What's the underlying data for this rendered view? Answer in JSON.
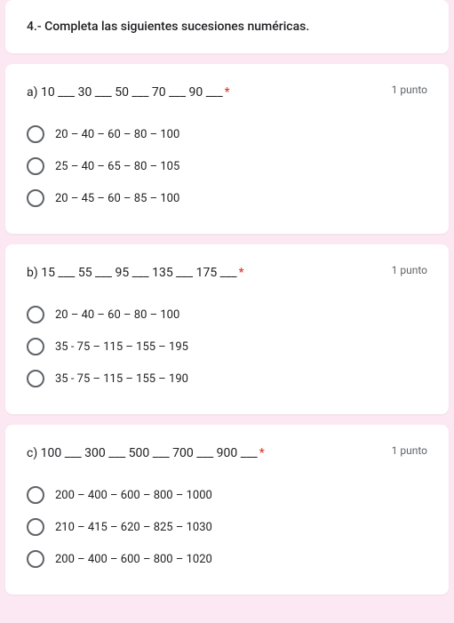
{
  "header": {
    "title": "4.- Completa las siguientes sucesiones numéricas."
  },
  "points_label": "1 punto",
  "questions": [
    {
      "text": "a) 10 ___ 30 ___ 50 ___ 70 ___ 90 ___",
      "options": [
        "20 – 40 – 60 – 80 – 100",
        "25 – 40 – 65 – 80 – 105",
        "20 – 45 – 60 – 85 – 100"
      ]
    },
    {
      "text": "b) 15 ___ 55 ___ 95 ___ 135 ___ 175 ___",
      "options": [
        "20 – 40 – 60 – 80 – 100",
        "35 - 75 – 115 – 155 – 195",
        "35 - 75 – 115 – 155 – 190"
      ]
    },
    {
      "text": "c) 100 ___ 300 ___ 500 ___ 700 ___ 900 ___",
      "options": [
        "200 – 400 – 600 – 800 – 1000",
        "210 – 415 – 620 – 825 – 1030",
        "200 – 400 – 600 – 800 – 1020"
      ]
    }
  ]
}
